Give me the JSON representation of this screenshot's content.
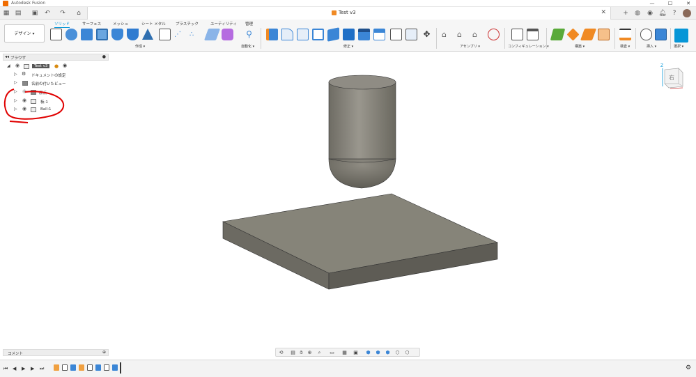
{
  "app": {
    "title": "Autodesk Fusion"
  },
  "window_controls": {
    "minimize": "—",
    "maximize": "☐",
    "close": "✕"
  },
  "document": {
    "tab_title": "Test v3"
  },
  "ribbon": {
    "workspace_label": "デザイン ▾",
    "tabs": [
      "ソリッド",
      "サーフェス",
      "メッシュ",
      "シート メタル",
      "プラスチック",
      "ユーティリティ",
      "管理"
    ],
    "groups": [
      "作成 ▾",
      "自動化 ▾",
      "修正 ▾",
      "アセンブリ ▾",
      "コンフィギュレーション ▾",
      "構築 ▾",
      "検査 ▾",
      "挿入 ▾",
      "選択 ▾"
    ]
  },
  "browser": {
    "title": "ブラウザ",
    "root": "Test v3",
    "items": [
      "ドキュメントの設定",
      "名前の付いたビュー",
      "原点",
      "板:1",
      "Ball:1"
    ]
  },
  "comments": {
    "title": "コメント"
  },
  "viewcube": {
    "face_label": "右",
    "axis_label": "Z"
  },
  "colors": {
    "accent": "#0696d7",
    "annotation": "#e00000",
    "model": "#7f7d75"
  }
}
